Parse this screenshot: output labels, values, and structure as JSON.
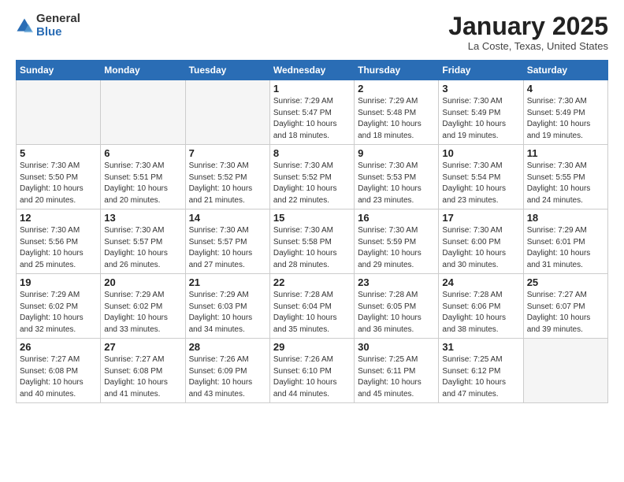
{
  "header": {
    "logo_general": "General",
    "logo_blue": "Blue",
    "month_title": "January 2025",
    "location": "La Coste, Texas, United States"
  },
  "weekdays": [
    "Sunday",
    "Monday",
    "Tuesday",
    "Wednesday",
    "Thursday",
    "Friday",
    "Saturday"
  ],
  "weeks": [
    [
      {
        "day": "",
        "info": ""
      },
      {
        "day": "",
        "info": ""
      },
      {
        "day": "",
        "info": ""
      },
      {
        "day": "1",
        "info": "Sunrise: 7:29 AM\nSunset: 5:47 PM\nDaylight: 10 hours\nand 18 minutes."
      },
      {
        "day": "2",
        "info": "Sunrise: 7:29 AM\nSunset: 5:48 PM\nDaylight: 10 hours\nand 18 minutes."
      },
      {
        "day": "3",
        "info": "Sunrise: 7:30 AM\nSunset: 5:49 PM\nDaylight: 10 hours\nand 19 minutes."
      },
      {
        "day": "4",
        "info": "Sunrise: 7:30 AM\nSunset: 5:49 PM\nDaylight: 10 hours\nand 19 minutes."
      }
    ],
    [
      {
        "day": "5",
        "info": "Sunrise: 7:30 AM\nSunset: 5:50 PM\nDaylight: 10 hours\nand 20 minutes."
      },
      {
        "day": "6",
        "info": "Sunrise: 7:30 AM\nSunset: 5:51 PM\nDaylight: 10 hours\nand 20 minutes."
      },
      {
        "day": "7",
        "info": "Sunrise: 7:30 AM\nSunset: 5:52 PM\nDaylight: 10 hours\nand 21 minutes."
      },
      {
        "day": "8",
        "info": "Sunrise: 7:30 AM\nSunset: 5:52 PM\nDaylight: 10 hours\nand 22 minutes."
      },
      {
        "day": "9",
        "info": "Sunrise: 7:30 AM\nSunset: 5:53 PM\nDaylight: 10 hours\nand 23 minutes."
      },
      {
        "day": "10",
        "info": "Sunrise: 7:30 AM\nSunset: 5:54 PM\nDaylight: 10 hours\nand 23 minutes."
      },
      {
        "day": "11",
        "info": "Sunrise: 7:30 AM\nSunset: 5:55 PM\nDaylight: 10 hours\nand 24 minutes."
      }
    ],
    [
      {
        "day": "12",
        "info": "Sunrise: 7:30 AM\nSunset: 5:56 PM\nDaylight: 10 hours\nand 25 minutes."
      },
      {
        "day": "13",
        "info": "Sunrise: 7:30 AM\nSunset: 5:57 PM\nDaylight: 10 hours\nand 26 minutes."
      },
      {
        "day": "14",
        "info": "Sunrise: 7:30 AM\nSunset: 5:57 PM\nDaylight: 10 hours\nand 27 minutes."
      },
      {
        "day": "15",
        "info": "Sunrise: 7:30 AM\nSunset: 5:58 PM\nDaylight: 10 hours\nand 28 minutes."
      },
      {
        "day": "16",
        "info": "Sunrise: 7:30 AM\nSunset: 5:59 PM\nDaylight: 10 hours\nand 29 minutes."
      },
      {
        "day": "17",
        "info": "Sunrise: 7:30 AM\nSunset: 6:00 PM\nDaylight: 10 hours\nand 30 minutes."
      },
      {
        "day": "18",
        "info": "Sunrise: 7:29 AM\nSunset: 6:01 PM\nDaylight: 10 hours\nand 31 minutes."
      }
    ],
    [
      {
        "day": "19",
        "info": "Sunrise: 7:29 AM\nSunset: 6:02 PM\nDaylight: 10 hours\nand 32 minutes."
      },
      {
        "day": "20",
        "info": "Sunrise: 7:29 AM\nSunset: 6:02 PM\nDaylight: 10 hours\nand 33 minutes."
      },
      {
        "day": "21",
        "info": "Sunrise: 7:29 AM\nSunset: 6:03 PM\nDaylight: 10 hours\nand 34 minutes."
      },
      {
        "day": "22",
        "info": "Sunrise: 7:28 AM\nSunset: 6:04 PM\nDaylight: 10 hours\nand 35 minutes."
      },
      {
        "day": "23",
        "info": "Sunrise: 7:28 AM\nSunset: 6:05 PM\nDaylight: 10 hours\nand 36 minutes."
      },
      {
        "day": "24",
        "info": "Sunrise: 7:28 AM\nSunset: 6:06 PM\nDaylight: 10 hours\nand 38 minutes."
      },
      {
        "day": "25",
        "info": "Sunrise: 7:27 AM\nSunset: 6:07 PM\nDaylight: 10 hours\nand 39 minutes."
      }
    ],
    [
      {
        "day": "26",
        "info": "Sunrise: 7:27 AM\nSunset: 6:08 PM\nDaylight: 10 hours\nand 40 minutes."
      },
      {
        "day": "27",
        "info": "Sunrise: 7:27 AM\nSunset: 6:08 PM\nDaylight: 10 hours\nand 41 minutes."
      },
      {
        "day": "28",
        "info": "Sunrise: 7:26 AM\nSunset: 6:09 PM\nDaylight: 10 hours\nand 43 minutes."
      },
      {
        "day": "29",
        "info": "Sunrise: 7:26 AM\nSunset: 6:10 PM\nDaylight: 10 hours\nand 44 minutes."
      },
      {
        "day": "30",
        "info": "Sunrise: 7:25 AM\nSunset: 6:11 PM\nDaylight: 10 hours\nand 45 minutes."
      },
      {
        "day": "31",
        "info": "Sunrise: 7:25 AM\nSunset: 6:12 PM\nDaylight: 10 hours\nand 47 minutes."
      },
      {
        "day": "",
        "info": ""
      }
    ]
  ]
}
